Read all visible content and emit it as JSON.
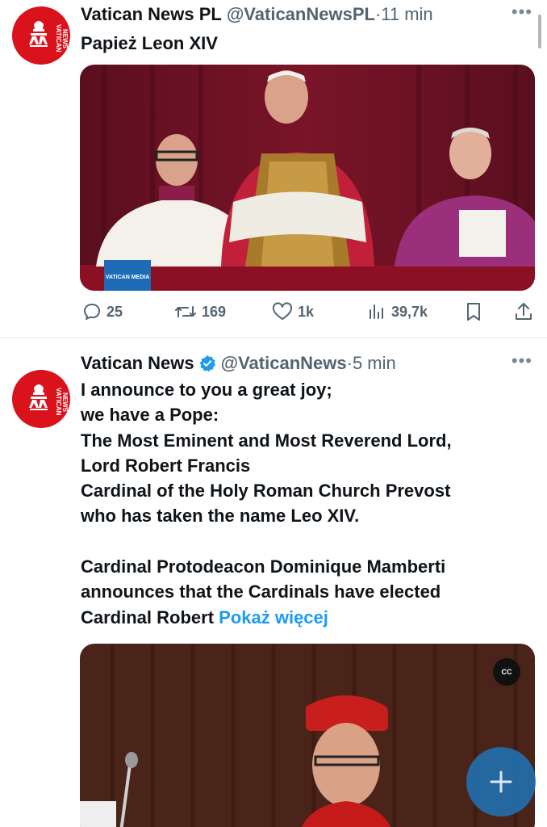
{
  "scroll_indicator": true,
  "tweets": [
    {
      "display_name": "Vatican News PL",
      "handle": "@VaticanNewsPL",
      "separator": "·",
      "time": "11 min",
      "verified": false,
      "text": "Papież Leon XIV",
      "more_icon": "more-horizontal-icon",
      "media": {
        "type": "photo",
        "badge_text": "VATICAN MEDIA"
      },
      "actions": {
        "replies": "25",
        "retweets": "169",
        "likes": "1k",
        "views": "39,7k"
      }
    },
    {
      "display_name": "Vatican News",
      "handle": "@VaticanNews",
      "separator": "·",
      "time": "5 min",
      "verified": true,
      "text": "I announce to you a great joy;\nwe have a Pope:\nThe Most Eminent and Most Reverend Lord,\nLord Robert Francis\nCardinal of the Holy Roman Church Prevost\nwho has taken the name Leo XIV.\n\nCardinal Protodeacon Dominique Mamberti\nannounces that the Cardinals have elected\nCardinal Robert ",
      "show_more": "Pokaż więcej",
      "more_icon": "more-horizontal-icon",
      "media": {
        "type": "video",
        "cc_label": "CC"
      }
    }
  ],
  "colors": {
    "brand_red": "#d9121b",
    "link_blue": "#1d9bf0",
    "secondary_text": "#536471",
    "fab_blue": "#1d78be"
  },
  "fab": {
    "icon": "plus-icon"
  }
}
